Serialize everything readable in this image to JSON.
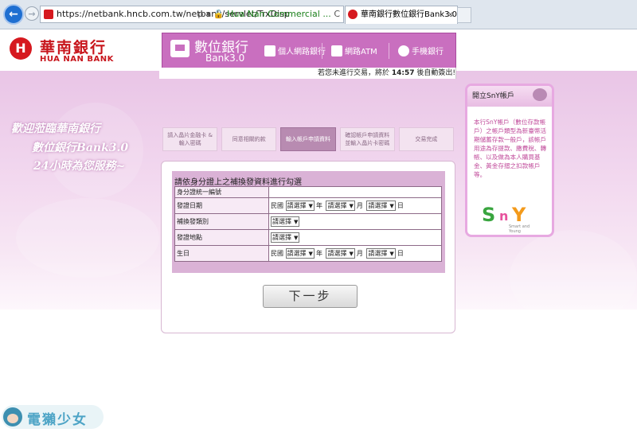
{
  "browser": {
    "url": "https://netbank.hncb.com.tw/netbank/servlet/TrxDisp",
    "address_icons": "ρ ▾",
    "site_identity": "Hua Nan Commercial ...",
    "refresh_glyph": "C",
    "tab_title": "華南銀行數位銀行Bank3.0...",
    "tab_close": "×"
  },
  "brand": {
    "mark": "H",
    "name_cn": "華南銀行",
    "name_en": "HUA NAN BANK"
  },
  "digital_bank": {
    "title": "數位銀行",
    "subtitle": "Bank3.0",
    "services": [
      "個人網路銀行",
      "網路ATM",
      "手機銀行"
    ]
  },
  "timer": {
    "prefix": "若您未進行交易，將於",
    "time": "14:57",
    "suffix": "後自動簽出!"
  },
  "welcome": {
    "line1": "歡迎蒞臨華南銀行",
    "line2": "數位銀行Bank3.0",
    "line3": "24小時為您服務~"
  },
  "steps": [
    "請入晶片金融卡 & 輸入密碼",
    "同意相關約款",
    "輸入帳戶申請資料",
    "確認帳戶申請資料 並輸入晶片卡密碼",
    "交易完成"
  ],
  "active_step": 2,
  "form": {
    "title": "請依身分證上之補換發資料進行勾選",
    "rows": [
      {
        "label": "身分證統一編號"
      },
      {
        "label": "發證日期"
      },
      {
        "label": "補換發類別"
      },
      {
        "label": "發證地點"
      },
      {
        "label": "生日"
      }
    ],
    "era": "民國",
    "select_placeholder": "請選擇",
    "units": [
      "年",
      "月",
      "日"
    ]
  },
  "next_button": "下一步",
  "sny": {
    "header": "開立SnY帳戶",
    "description": "本行SnY帳戶（數位存款帳戶）之帳戶類型為新臺幣活期儲蓄存款一般戶，該帳戶用途為存提款、繳費稅、轉帳、以及做為本人購買基金、黃金存摺之扣款帳戶等。",
    "logo_s": "S",
    "logo_n": "n",
    "logo_y": "Y",
    "logo_tag": "Smart and Young"
  },
  "watermark": {
    "text": "電獺少女"
  },
  "colors": {
    "brand_red": "#c8161d",
    "accent_purple": "#c96fbf",
    "form_bg": "#dab2d6"
  }
}
